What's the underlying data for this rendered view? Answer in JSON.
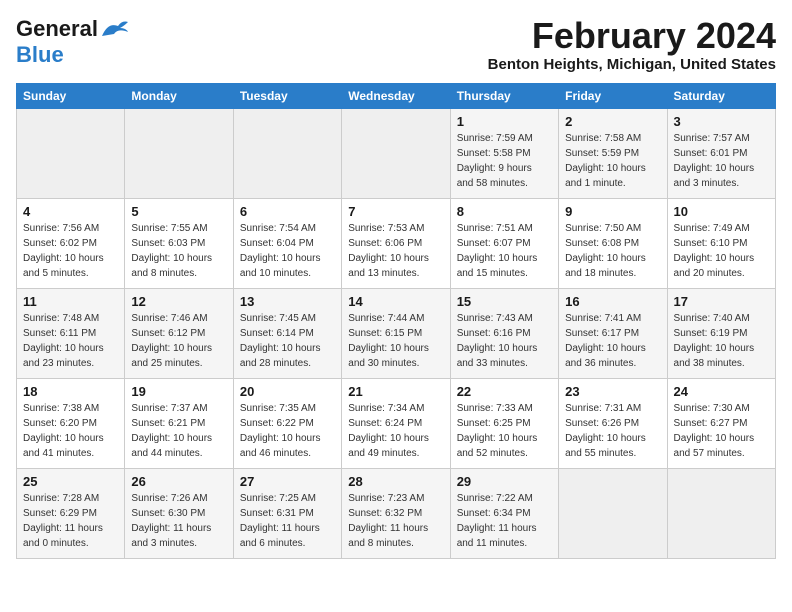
{
  "header": {
    "logo_line1": "General",
    "logo_line2": "Blue",
    "main_title": "February 2024",
    "subtitle": "Benton Heights, Michigan, United States"
  },
  "calendar": {
    "columns": [
      "Sunday",
      "Monday",
      "Tuesday",
      "Wednesday",
      "Thursday",
      "Friday",
      "Saturday"
    ],
    "weeks": [
      [
        {
          "day": "",
          "info": ""
        },
        {
          "day": "",
          "info": ""
        },
        {
          "day": "",
          "info": ""
        },
        {
          "day": "",
          "info": ""
        },
        {
          "day": "1",
          "info": "Sunrise: 7:59 AM\nSunset: 5:58 PM\nDaylight: 9 hours\nand 58 minutes."
        },
        {
          "day": "2",
          "info": "Sunrise: 7:58 AM\nSunset: 5:59 PM\nDaylight: 10 hours\nand 1 minute."
        },
        {
          "day": "3",
          "info": "Sunrise: 7:57 AM\nSunset: 6:01 PM\nDaylight: 10 hours\nand 3 minutes."
        }
      ],
      [
        {
          "day": "4",
          "info": "Sunrise: 7:56 AM\nSunset: 6:02 PM\nDaylight: 10 hours\nand 5 minutes."
        },
        {
          "day": "5",
          "info": "Sunrise: 7:55 AM\nSunset: 6:03 PM\nDaylight: 10 hours\nand 8 minutes."
        },
        {
          "day": "6",
          "info": "Sunrise: 7:54 AM\nSunset: 6:04 PM\nDaylight: 10 hours\nand 10 minutes."
        },
        {
          "day": "7",
          "info": "Sunrise: 7:53 AM\nSunset: 6:06 PM\nDaylight: 10 hours\nand 13 minutes."
        },
        {
          "day": "8",
          "info": "Sunrise: 7:51 AM\nSunset: 6:07 PM\nDaylight: 10 hours\nand 15 minutes."
        },
        {
          "day": "9",
          "info": "Sunrise: 7:50 AM\nSunset: 6:08 PM\nDaylight: 10 hours\nand 18 minutes."
        },
        {
          "day": "10",
          "info": "Sunrise: 7:49 AM\nSunset: 6:10 PM\nDaylight: 10 hours\nand 20 minutes."
        }
      ],
      [
        {
          "day": "11",
          "info": "Sunrise: 7:48 AM\nSunset: 6:11 PM\nDaylight: 10 hours\nand 23 minutes."
        },
        {
          "day": "12",
          "info": "Sunrise: 7:46 AM\nSunset: 6:12 PM\nDaylight: 10 hours\nand 25 minutes."
        },
        {
          "day": "13",
          "info": "Sunrise: 7:45 AM\nSunset: 6:14 PM\nDaylight: 10 hours\nand 28 minutes."
        },
        {
          "day": "14",
          "info": "Sunrise: 7:44 AM\nSunset: 6:15 PM\nDaylight: 10 hours\nand 30 minutes."
        },
        {
          "day": "15",
          "info": "Sunrise: 7:43 AM\nSunset: 6:16 PM\nDaylight: 10 hours\nand 33 minutes."
        },
        {
          "day": "16",
          "info": "Sunrise: 7:41 AM\nSunset: 6:17 PM\nDaylight: 10 hours\nand 36 minutes."
        },
        {
          "day": "17",
          "info": "Sunrise: 7:40 AM\nSunset: 6:19 PM\nDaylight: 10 hours\nand 38 minutes."
        }
      ],
      [
        {
          "day": "18",
          "info": "Sunrise: 7:38 AM\nSunset: 6:20 PM\nDaylight: 10 hours\nand 41 minutes."
        },
        {
          "day": "19",
          "info": "Sunrise: 7:37 AM\nSunset: 6:21 PM\nDaylight: 10 hours\nand 44 minutes."
        },
        {
          "day": "20",
          "info": "Sunrise: 7:35 AM\nSunset: 6:22 PM\nDaylight: 10 hours\nand 46 minutes."
        },
        {
          "day": "21",
          "info": "Sunrise: 7:34 AM\nSunset: 6:24 PM\nDaylight: 10 hours\nand 49 minutes."
        },
        {
          "day": "22",
          "info": "Sunrise: 7:33 AM\nSunset: 6:25 PM\nDaylight: 10 hours\nand 52 minutes."
        },
        {
          "day": "23",
          "info": "Sunrise: 7:31 AM\nSunset: 6:26 PM\nDaylight: 10 hours\nand 55 minutes."
        },
        {
          "day": "24",
          "info": "Sunrise: 7:30 AM\nSunset: 6:27 PM\nDaylight: 10 hours\nand 57 minutes."
        }
      ],
      [
        {
          "day": "25",
          "info": "Sunrise: 7:28 AM\nSunset: 6:29 PM\nDaylight: 11 hours\nand 0 minutes."
        },
        {
          "day": "26",
          "info": "Sunrise: 7:26 AM\nSunset: 6:30 PM\nDaylight: 11 hours\nand 3 minutes."
        },
        {
          "day": "27",
          "info": "Sunrise: 7:25 AM\nSunset: 6:31 PM\nDaylight: 11 hours\nand 6 minutes."
        },
        {
          "day": "28",
          "info": "Sunrise: 7:23 AM\nSunset: 6:32 PM\nDaylight: 11 hours\nand 8 minutes."
        },
        {
          "day": "29",
          "info": "Sunrise: 7:22 AM\nSunset: 6:34 PM\nDaylight: 11 hours\nand 11 minutes."
        },
        {
          "day": "",
          "info": ""
        },
        {
          "day": "",
          "info": ""
        }
      ]
    ]
  }
}
